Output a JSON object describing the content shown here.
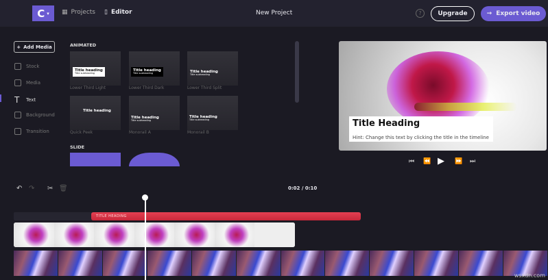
{
  "topbar": {
    "logo": "C",
    "nav": [
      {
        "label": "Projects",
        "icon": "film-icon"
      },
      {
        "label": "Editor",
        "icon": "document-icon"
      }
    ],
    "title": "New Project",
    "help": "?",
    "upgrade": "Upgrade",
    "export": "Export video",
    "export_icon": "→"
  },
  "sidebar": {
    "add_media": "Add Media",
    "items": [
      {
        "label": "Stock"
      },
      {
        "label": "Media"
      },
      {
        "label": "Text",
        "active": true
      },
      {
        "label": "Background"
      },
      {
        "label": "Transition"
      }
    ]
  },
  "library": {
    "animated_label": "ANIMATED",
    "slide_label": "SLIDE",
    "templates": [
      {
        "name": "Lower Third Light",
        "heading": "Title heading",
        "sub": "Title subheading"
      },
      {
        "name": "Lower Third Dark",
        "heading": "Title heading",
        "sub": "Title subheading"
      },
      {
        "name": "Lower Third Split",
        "heading": "Title heading",
        "sub": "Title subheading"
      },
      {
        "name": "Quick Peek",
        "heading": "Title heading"
      },
      {
        "name": "Monorail A",
        "heading": "Title heading",
        "sub": "Title subheading"
      },
      {
        "name": "Monorail B",
        "heading": "Title heading",
        "sub": "Title subheading"
      }
    ]
  },
  "preview": {
    "title": "Title Heading",
    "hint": "Hint: Change this text by clicking the title in the timeline"
  },
  "timeline": {
    "time": "0:02 / 0:10",
    "title_clip": "TITLE HEADING"
  },
  "watermark": "wsxdn.com",
  "colors": {
    "accent": "#6b5bd2",
    "title_track": "#d9344a"
  }
}
